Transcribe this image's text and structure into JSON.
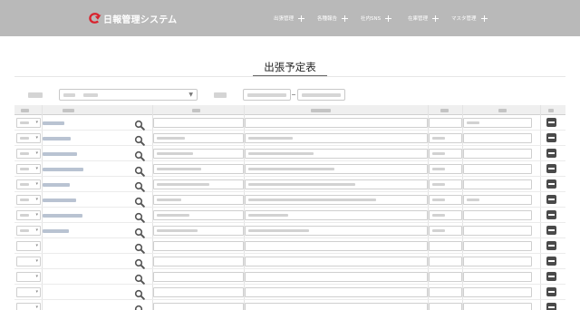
{
  "header": {
    "app_title": "日報管理システム",
    "nav": [
      {
        "label": "出張管理"
      },
      {
        "label": "各種報告"
      },
      {
        "label": "社内SNS"
      },
      {
        "label": "在庫管理"
      },
      {
        "label": "マスタ管理"
      }
    ]
  },
  "page": {
    "title": "出張予定表",
    "note": ""
  },
  "filters": {
    "select_label": "",
    "select_value": "",
    "date_label": "",
    "date_from": "",
    "date_to": ""
  },
  "table": {
    "columns": [
      "",
      "",
      "",
      "",
      "",
      "",
      "",
      ""
    ],
    "rows": [
      {
        "has_name": true,
        "has_name_cell": false,
        "has_destination": false,
        "has_purpose": false,
        "has_time": false,
        "has_remarks": true
      },
      {
        "has_name": true,
        "has_name_cell": true,
        "has_destination": true,
        "has_purpose": true,
        "has_time": true,
        "has_remarks": false
      },
      {
        "has_name": true,
        "has_name_cell": true,
        "has_destination": true,
        "has_purpose": true,
        "has_time": true,
        "has_remarks": false
      },
      {
        "has_name": true,
        "has_name_cell": true,
        "has_destination": true,
        "has_purpose": true,
        "has_time": true,
        "has_remarks": false
      },
      {
        "has_name": true,
        "has_name_cell": true,
        "has_destination": true,
        "has_purpose": true,
        "has_time": true,
        "has_remarks": false
      },
      {
        "has_name": true,
        "has_name_cell": true,
        "has_destination": true,
        "has_purpose": true,
        "has_time": true,
        "has_remarks": true
      },
      {
        "has_name": true,
        "has_name_cell": true,
        "has_destination": true,
        "has_purpose": true,
        "has_time": true,
        "has_remarks": false
      },
      {
        "has_name": true,
        "has_name_cell": true,
        "has_destination": true,
        "has_purpose": true,
        "has_time": true,
        "has_remarks": false
      },
      {
        "has_name": false,
        "has_name_cell": false,
        "has_destination": false,
        "has_purpose": false,
        "has_time": false,
        "has_remarks": false
      },
      {
        "has_name": false,
        "has_name_cell": false,
        "has_destination": false,
        "has_purpose": false,
        "has_time": false,
        "has_remarks": false
      },
      {
        "has_name": false,
        "has_name_cell": false,
        "has_destination": false,
        "has_purpose": false,
        "has_time": false,
        "has_remarks": false
      },
      {
        "has_name": false,
        "has_name_cell": false,
        "has_destination": false,
        "has_purpose": false,
        "has_time": false,
        "has_remarks": false
      },
      {
        "has_name": false,
        "has_name_cell": false,
        "has_destination": false,
        "has_purpose": false,
        "has_time": false,
        "has_remarks": false
      }
    ]
  },
  "colors": {
    "header_bg": "#b9b9b9",
    "brand_red": "#d9232e",
    "delete_button": "#4a4a4a"
  }
}
